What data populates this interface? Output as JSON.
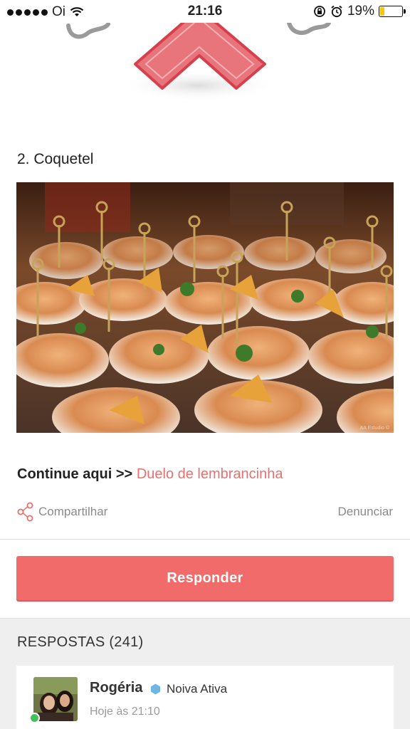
{
  "status_bar": {
    "carrier": "Oi",
    "time": "21:16",
    "battery_percent": "19%",
    "battery_level": 0.19,
    "icons": [
      "signal-dots-icon",
      "wifi-icon",
      "rotation-lock-icon",
      "alarm-icon",
      "battery-icon"
    ]
  },
  "post": {
    "step_title": "2. Coquetel",
    "photo_credit": "AA Estudio ©",
    "continue_label": "Continue aqui >>",
    "continue_link": "Duelo de lembrancinha",
    "share_label": "Compartilhar",
    "report_label": "Denunciar"
  },
  "reply": {
    "button_label": "Responder"
  },
  "answers": {
    "title": "RESPOSTAS (241)",
    "items": [
      {
        "name": "Rogéria",
        "badge": "Noiva Ativa",
        "time": "Hoje às 21:10"
      }
    ]
  },
  "colors": {
    "accent": "#f26b6b",
    "link": "#e8706f",
    "badge_hex": "#6fb7e0",
    "online": "#43c15c"
  }
}
